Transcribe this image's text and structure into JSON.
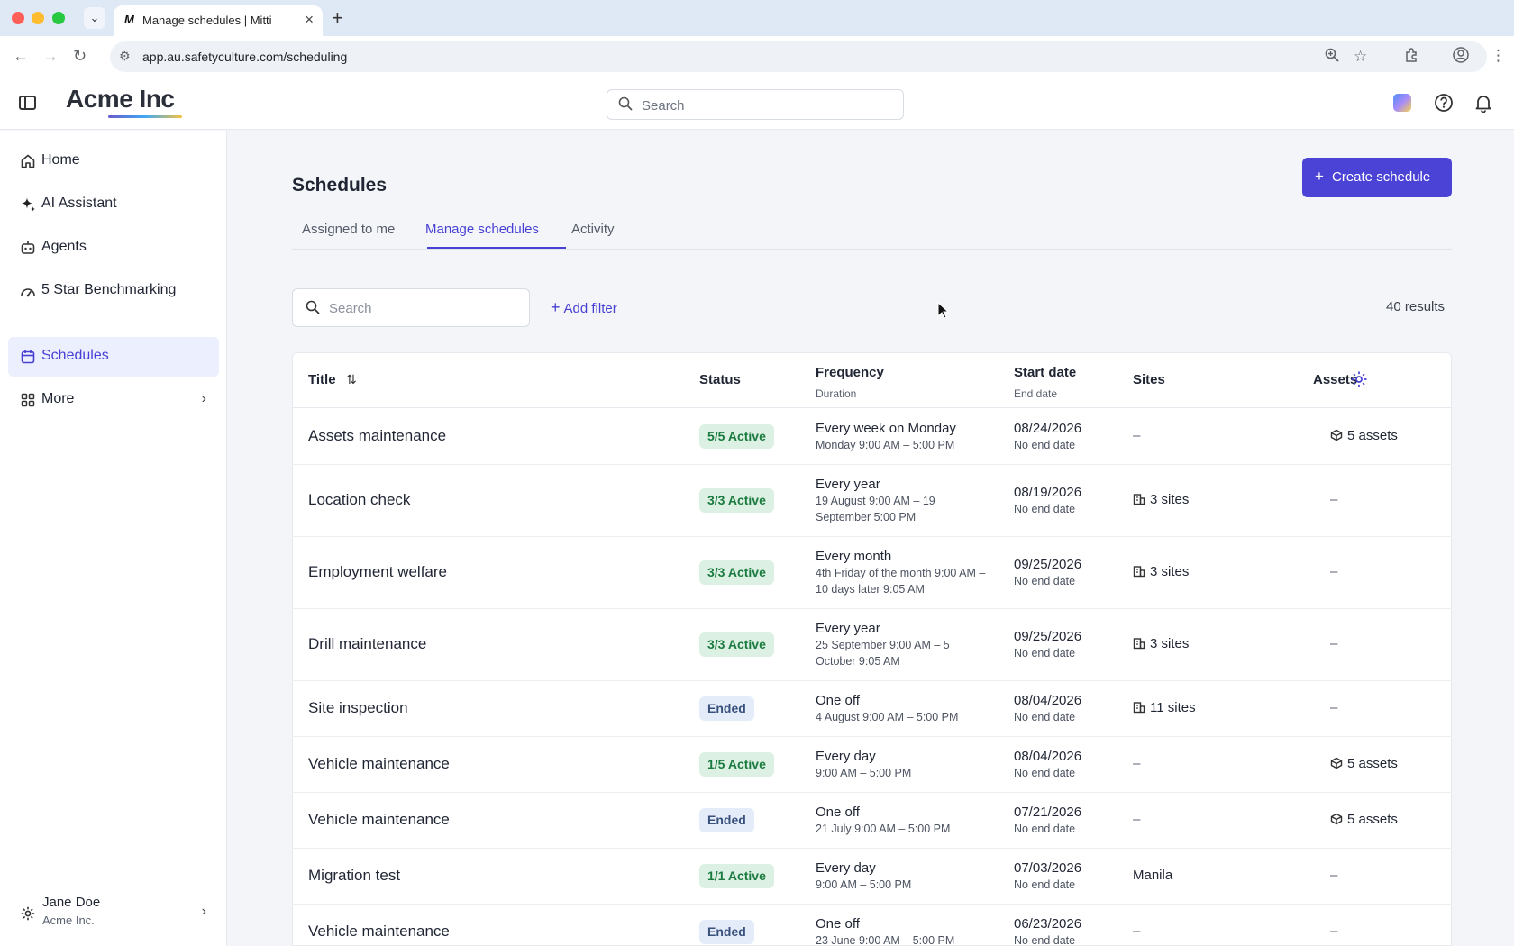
{
  "browser": {
    "tab_title": "Manage schedules | Mitti",
    "tab_favicon": "M",
    "url": "app.au.safetyculture.com/scheduling"
  },
  "header": {
    "logo_text": "Acme Inc",
    "search_placeholder": "Search"
  },
  "sidebar": {
    "items": [
      {
        "label": "Home",
        "icon": "home-icon"
      },
      {
        "label": "AI Assistant",
        "icon": "sparkle-icon"
      },
      {
        "label": "Agents",
        "icon": "robot-icon"
      },
      {
        "label": "5 Star Benchmarking",
        "icon": "gauge-icon"
      },
      {
        "label": "Schedules",
        "icon": "calendar-icon",
        "active": true
      },
      {
        "label": "More",
        "icon": "grid-icon"
      }
    ],
    "user": {
      "name": "Jane Doe",
      "org": "Acme Inc."
    }
  },
  "main": {
    "title": "Schedules",
    "create_button": "Create schedule",
    "tabs": [
      {
        "label": "Assigned to me"
      },
      {
        "label": "Manage schedules",
        "active": true
      },
      {
        "label": "Activity"
      }
    ],
    "search_placeholder": "Search",
    "add_filter": "Add filter",
    "results": "40 results"
  },
  "table": {
    "headers": {
      "title": "Title",
      "status": "Status",
      "frequency": "Frequency",
      "frequency_sub": "Duration",
      "start": "Start date",
      "start_sub": "End date",
      "sites": "Sites",
      "assets": "Assets"
    },
    "rows": [
      {
        "title": "Assets maintenance",
        "status": "5/5 Active",
        "status_type": "active",
        "freq": "Every week on Monday",
        "duration": "Monday 9:00 AM – 5:00 PM",
        "start": "08/24/2026",
        "end": "No end date",
        "sites": "–",
        "assets": "5 assets"
      },
      {
        "title": "Location check",
        "status": "3/3 Active",
        "status_type": "active",
        "freq": "Every year",
        "duration": "19 August 9:00 AM – 19 September 5:00 PM",
        "start": "08/19/2026",
        "end": "No end date",
        "sites": "3 sites",
        "assets": "–"
      },
      {
        "title": "Employment welfare",
        "status": "3/3 Active",
        "status_type": "active",
        "freq": "Every month",
        "duration": "4th Friday of the month 9:00 AM – 10 days later 9:05 AM",
        "start": "09/25/2026",
        "end": "No end date",
        "sites": "3 sites",
        "assets": "–"
      },
      {
        "title": "Drill maintenance",
        "status": "3/3 Active",
        "status_type": "active",
        "freq": "Every year",
        "duration": "25 September 9:00 AM – 5 October 9:05 AM",
        "start": "09/25/2026",
        "end": "No end date",
        "sites": "3 sites",
        "assets": "–"
      },
      {
        "title": "Site inspection",
        "status": "Ended",
        "status_type": "ended",
        "freq": "One off",
        "duration": "4 August 9:00 AM – 5:00 PM",
        "start": "08/04/2026",
        "end": "No end date",
        "sites": "11 sites",
        "assets": "–"
      },
      {
        "title": "Vehicle maintenance",
        "status": "1/5 Active",
        "status_type": "active",
        "freq": "Every day",
        "duration": "9:00 AM – 5:00 PM",
        "start": "08/04/2026",
        "end": "No end date",
        "sites": "–",
        "assets": "5 assets"
      },
      {
        "title": "Vehicle maintenance",
        "status": "Ended",
        "status_type": "ended",
        "freq": "One off",
        "duration": "21 July 9:00 AM – 5:00 PM",
        "start": "07/21/2026",
        "end": "No end date",
        "sites": "–",
        "assets": "5 assets"
      },
      {
        "title": "Migration test",
        "status": "1/1 Active",
        "status_type": "active",
        "freq": "Every day",
        "duration": "9:00 AM – 5:00 PM",
        "start": "07/03/2026",
        "end": "No end date",
        "sites": "Manila",
        "assets": "–"
      },
      {
        "title": "Vehicle maintenance",
        "status": "Ended",
        "status_type": "ended",
        "freq": "One off",
        "duration": "23 June 9:00 AM – 5:00 PM",
        "start": "06/23/2026",
        "end": "No end date",
        "sites": "–",
        "assets": "–"
      }
    ]
  }
}
